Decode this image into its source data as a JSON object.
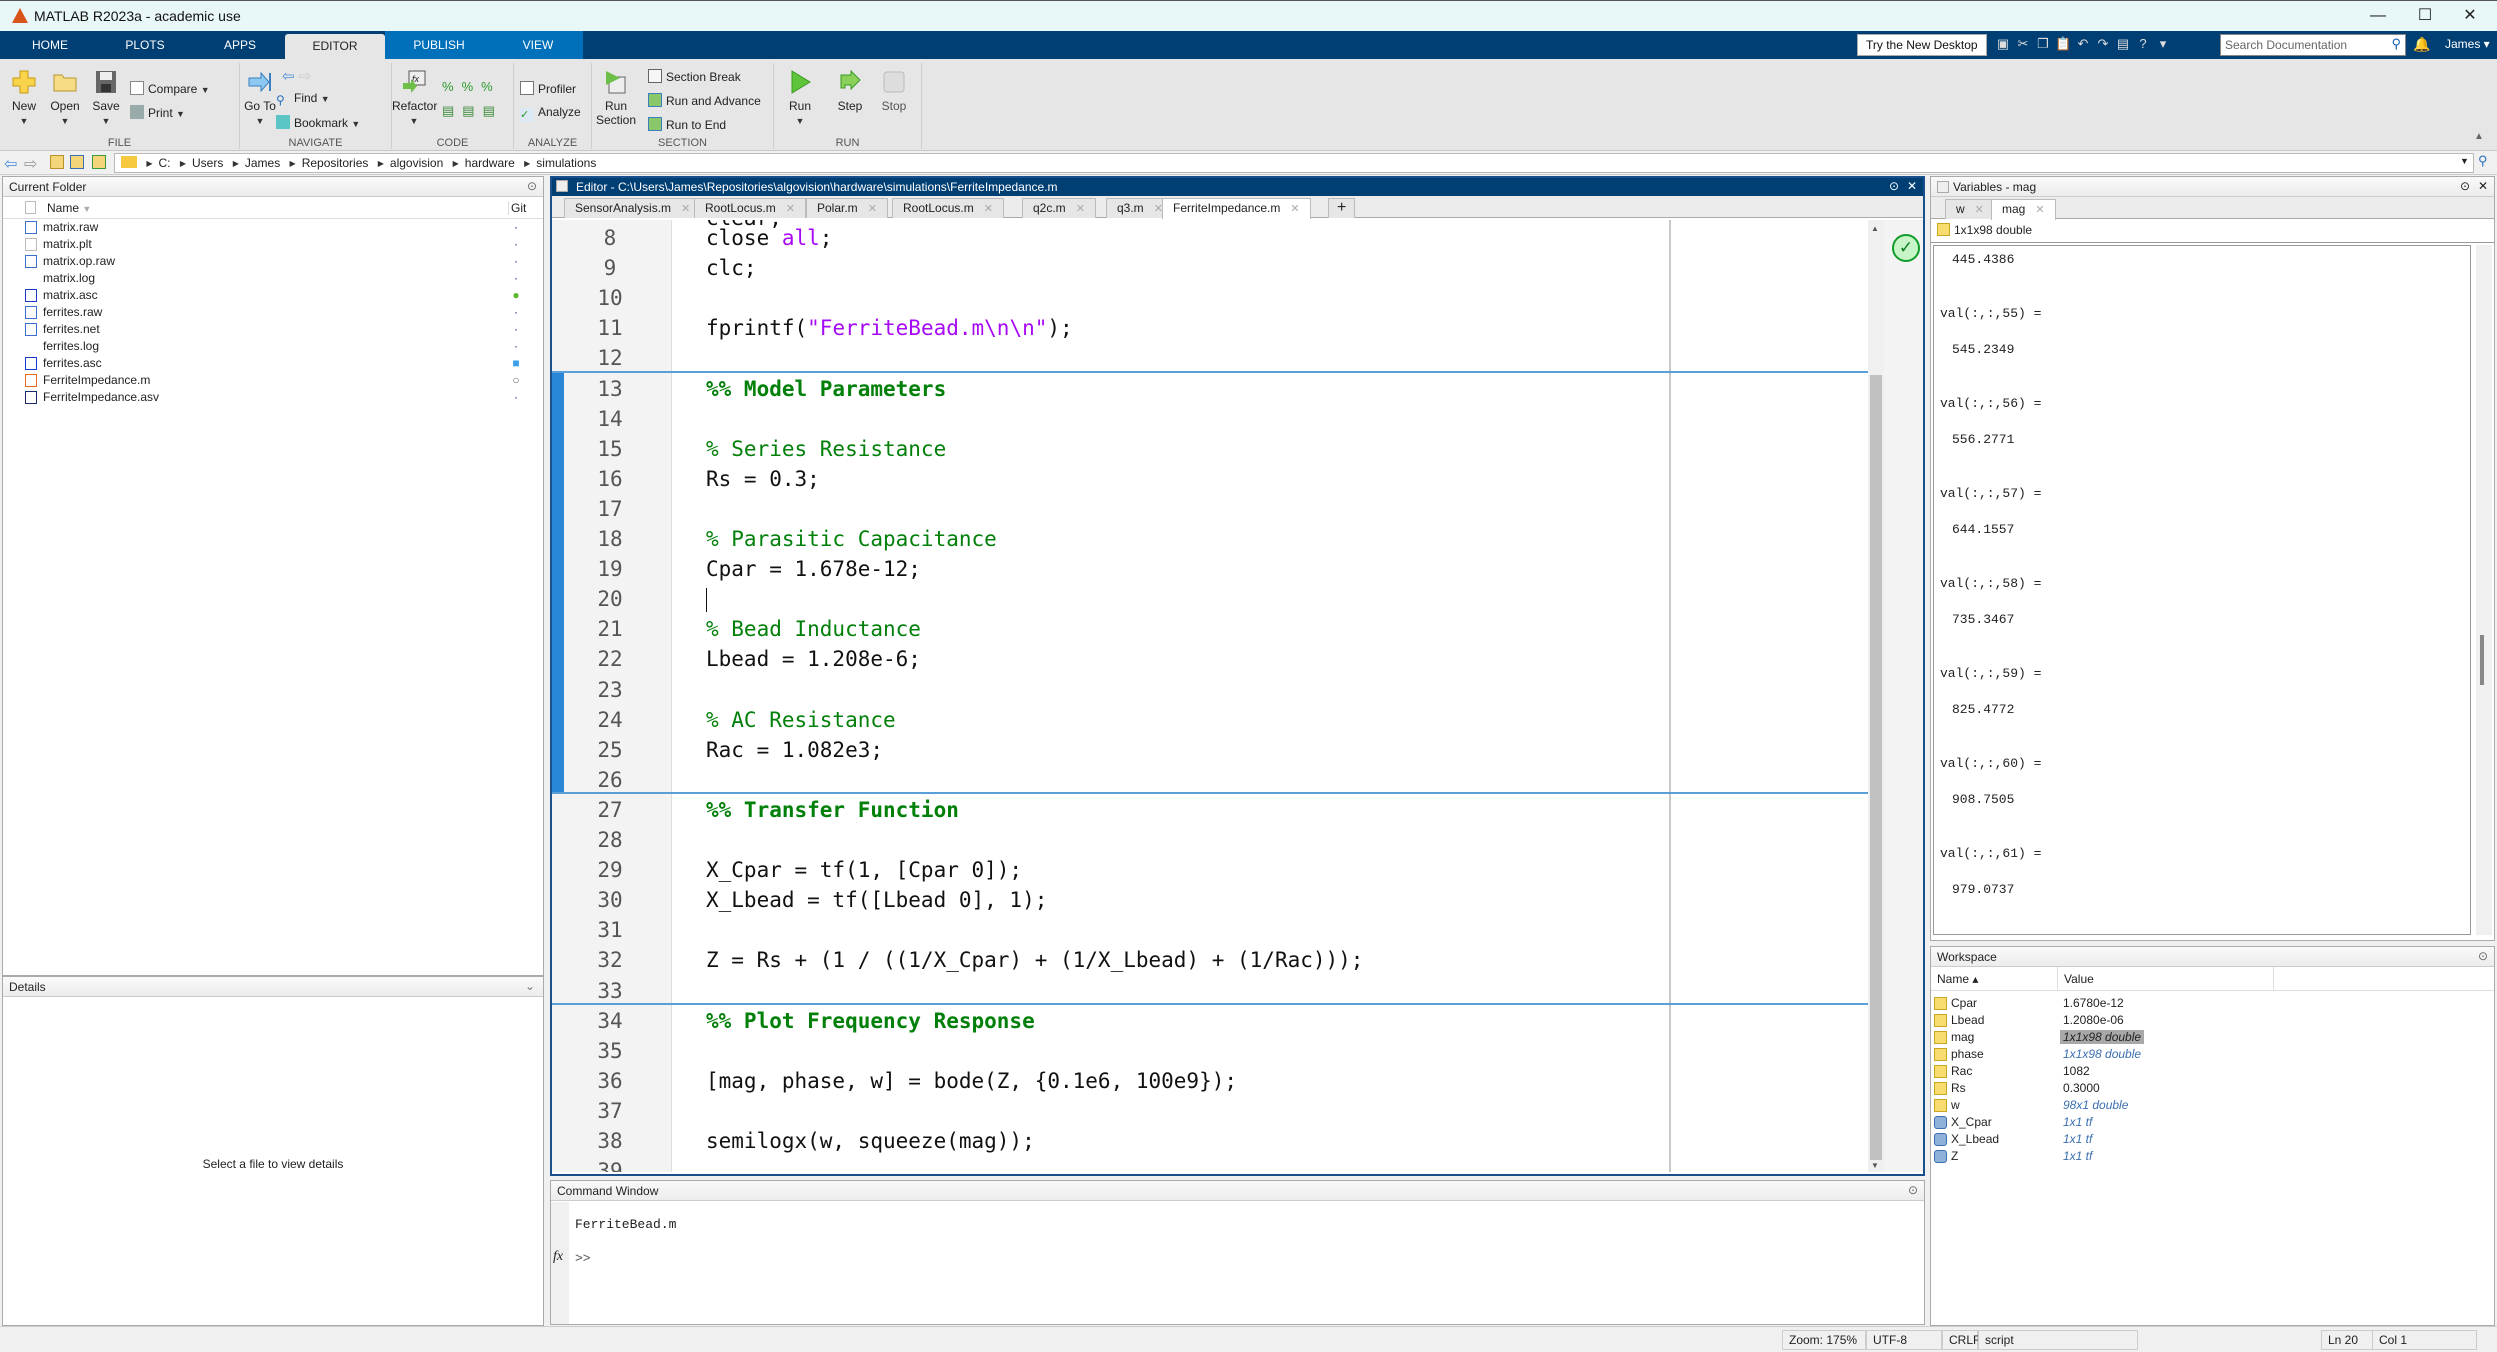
{
  "window": {
    "title": "MATLAB R2023a - academic use",
    "minimize": "—",
    "maximize": "☐",
    "close": "✕"
  },
  "ribbon_tabs": [
    "HOME",
    "PLOTS",
    "APPS",
    "EDITOR",
    "PUBLISH",
    "VIEW"
  ],
  "active_tab": "EDITOR",
  "topbar": {
    "try_new_desktop": "Try the New Desktop",
    "search_placeholder": "Search Documentation",
    "user": "James ▾"
  },
  "toolstrip": {
    "file": {
      "label": "FILE",
      "new": "New",
      "open": "Open",
      "save": "Save",
      "compare": "Compare",
      "print": "Print"
    },
    "navigate": {
      "label": "NAVIGATE",
      "goto": "Go To",
      "find": "Find",
      "bookmark": "Bookmark"
    },
    "code": {
      "label": "CODE",
      "refactor": "Refactor"
    },
    "analyze": {
      "label": "ANALYZE",
      "profiler": "Profiler",
      "analyze": "Analyze"
    },
    "section": {
      "label": "SECTION",
      "run_section": "Run Section",
      "section_break": "Section Break",
      "run_and_advance": "Run and Advance",
      "run_to_end": "Run to End"
    },
    "run": {
      "label": "RUN",
      "run": "Run",
      "step": "Step",
      "stop": "Stop"
    }
  },
  "address": {
    "crumbs": [
      "C:",
      "Users",
      "James",
      "Repositories",
      "algovision",
      "hardware",
      "simulations"
    ]
  },
  "current_folder": {
    "title": "Current Folder",
    "col_name": "Name",
    "col_git": "Git",
    "files": [
      {
        "name": "matrix.raw",
        "git": "·"
      },
      {
        "name": "matrix.plt",
        "git": "·"
      },
      {
        "name": "matrix.op.raw",
        "git": "·"
      },
      {
        "name": "matrix.log",
        "git": "·"
      },
      {
        "name": "matrix.asc",
        "git": "●"
      },
      {
        "name": "ferrites.raw",
        "git": "·"
      },
      {
        "name": "ferrites.net",
        "git": "·"
      },
      {
        "name": "ferrites.log",
        "git": "·"
      },
      {
        "name": "ferrites.asc",
        "git": "■"
      },
      {
        "name": "FerriteImpedance.m",
        "git": "○"
      },
      {
        "name": "FerriteImpedance.asv",
        "git": "·"
      }
    ]
  },
  "details": {
    "title": "Details",
    "empty": "Select a file to view details"
  },
  "editor": {
    "title": "Editor - C:\\Users\\James\\Repositories\\algovision\\hardware\\simulations\\FerriteImpedance.m",
    "tabs": [
      "SensorAnalysis.m",
      "RootLocus.m",
      "Polar.m",
      "RootLocus.m",
      "q2c.m",
      "q3.m",
      "FerriteImpedance.m"
    ],
    "active_tab": "FerriteImpedance.m",
    "add_tab": "+",
    "lines": [
      {
        "n": "8",
        "t": "close all;"
      },
      {
        "n": "9",
        "t": "clc;"
      },
      {
        "n": "10",
        "t": ""
      },
      {
        "n": "11",
        "t": "fprintf(\"FerriteBead.m\\n\\n\");"
      },
      {
        "n": "12",
        "t": ""
      },
      {
        "n": "13",
        "t": "%% Model Parameters"
      },
      {
        "n": "14",
        "t": ""
      },
      {
        "n": "15",
        "t": "% Series Resistance"
      },
      {
        "n": "16",
        "t": "Rs = 0.3;"
      },
      {
        "n": "17",
        "t": ""
      },
      {
        "n": "18",
        "t": "% Parasitic Capacitance"
      },
      {
        "n": "19",
        "t": "Cpar = 1.678e-12;"
      },
      {
        "n": "20",
        "t": ""
      },
      {
        "n": "21",
        "t": "% Bead Inductance"
      },
      {
        "n": "22",
        "t": "Lbead = 1.208e-6;"
      },
      {
        "n": "23",
        "t": ""
      },
      {
        "n": "24",
        "t": "% AC Resistance"
      },
      {
        "n": "25",
        "t": "Rac = 1.082e3;"
      },
      {
        "n": "26",
        "t": ""
      },
      {
        "n": "27",
        "t": "%% Transfer Function"
      },
      {
        "n": "28",
        "t": ""
      },
      {
        "n": "29",
        "t": "X_Cpar = tf(1, [Cpar 0]);"
      },
      {
        "n": "30",
        "t": "X_Lbead = tf([Lbead 0], 1);"
      },
      {
        "n": "31",
        "t": ""
      },
      {
        "n": "32",
        "t": "Z = Rs + (1 / ((1/X_Cpar) + (1/X_Lbead) + (1/Rac)));"
      },
      {
        "n": "33",
        "t": ""
      },
      {
        "n": "34",
        "t": "%% Plot Frequency Response"
      },
      {
        "n": "35",
        "t": ""
      },
      {
        "n": "36",
        "t": "[mag, phase, w] = bode(Z, {0.1e6, 100e9});"
      },
      {
        "n": "37",
        "t": ""
      },
      {
        "n": "38",
        "t": "semilogx(w, squeeze(mag));"
      },
      {
        "n": "39",
        "t": ""
      }
    ]
  },
  "command_window": {
    "title": "Command Window",
    "output": "FerriteBead.m",
    "prompt": ">>",
    "fx": "fx"
  },
  "variables": {
    "title": "Variables - mag",
    "tabs": [
      "w",
      "mag"
    ],
    "active_tab": "mag",
    "info": "1x1x98 double",
    "entries": [
      {
        "label": "",
        "value": "445.4386"
      },
      {
        "label": "val(:,:,55) =",
        "value": "545.2349"
      },
      {
        "label": "val(:,:,56) =",
        "value": "556.2771"
      },
      {
        "label": "val(:,:,57) =",
        "value": "644.1557"
      },
      {
        "label": "val(:,:,58) =",
        "value": "735.3467"
      },
      {
        "label": "val(:,:,59) =",
        "value": "825.4772"
      },
      {
        "label": "val(:,:,60) =",
        "value": "908.7505"
      },
      {
        "label": "val(:,:,61) =",
        "value": "979.0737"
      }
    ]
  },
  "workspace": {
    "title": "Workspace",
    "col_name": "Name ▴",
    "col_value": "Value",
    "rows": [
      {
        "name": "Cpar",
        "value": "1.6780e-12",
        "kind": "double"
      },
      {
        "name": "Lbead",
        "value": "1.2080e-06",
        "kind": "double"
      },
      {
        "name": "mag",
        "value": "1x1x98 double",
        "kind": "selected"
      },
      {
        "name": "phase",
        "value": "1x1x98 double",
        "kind": "italic"
      },
      {
        "name": "Rac",
        "value": "1082",
        "kind": "double"
      },
      {
        "name": "Rs",
        "value": "0.3000",
        "kind": "double"
      },
      {
        "name": "w",
        "value": "98x1 double",
        "kind": "italic"
      },
      {
        "name": "X_Cpar",
        "value": "1x1 tf",
        "kind": "object"
      },
      {
        "name": "X_Lbead",
        "value": "1x1 tf",
        "kind": "object"
      },
      {
        "name": "Z",
        "value": "1x1 tf",
        "kind": "object"
      }
    ]
  },
  "status": {
    "zoom": "Zoom: 175%",
    "encoding": "UTF-8",
    "eol": "CRLF",
    "type": "script",
    "ln": "Ln  20",
    "col": "Col  1"
  },
  "colors": {
    "ribbon": "#003f74",
    "publish_tab": "#0070ba",
    "comment": "#028009",
    "string": "#a709f5",
    "keyword": "#0e00ff",
    "section_bar": "#2a87d8"
  }
}
